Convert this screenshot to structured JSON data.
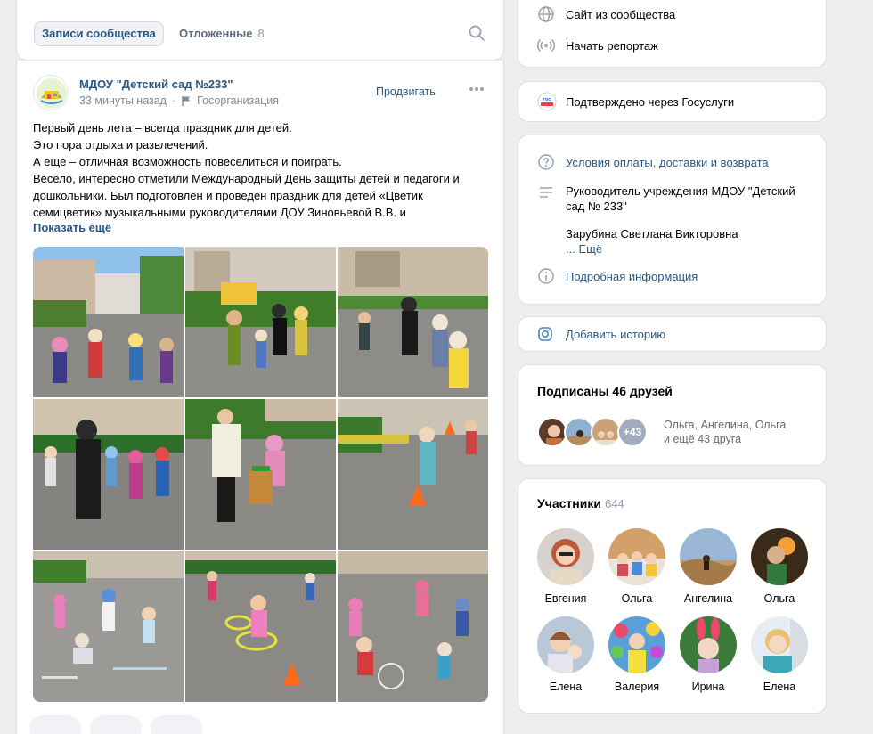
{
  "tabs": {
    "active": "Записи сообщества",
    "postponed": "Отложенные",
    "postponed_count": "8"
  },
  "post": {
    "author": "МДОУ \"Детский сад №233\"",
    "time": "33 минуты назад",
    "separator": "·",
    "org_type": "Госорганизация",
    "promote": "Продвигать",
    "text_lines": [
      "Первый день лета – всегда праздник для детей.",
      "Это пора отдыха и развлечений.",
      "А еще – отличная возможность повеселиться и поиграть.",
      "Весело, интересно отметили Международный День защиты детей и педагоги и",
      "дошкольники. Был подготовлен и проведен праздник для детей «Цветик",
      "семицветик» музыкальными руководителями ДОУ Зиновьевой В.В. и"
    ],
    "show_more": "Показать ещё"
  },
  "links": {
    "site": "Сайт из сообщества",
    "report": "Начать репортаж"
  },
  "gos": {
    "label": "Подтверждено через Госуслуги",
    "badge": "ГОС УСЛУГИ"
  },
  "info": {
    "terms": "Условия оплаты, доставки и возврата",
    "head_line1": "Руководитель учреждения МДОУ \"Детский",
    "head_line2": "сад № 233\"",
    "head_name": "Зарубина Светлана Викторовна",
    "more": "... Ещё",
    "details": "Подробная информация"
  },
  "story": {
    "label": "Добавить историю"
  },
  "friends": {
    "title": "Подписаны 46 друзей",
    "more_badge": "+43",
    "names_line1": "Ольга, Ангелина, Ольга",
    "names_line2": "и ещё 43 друга"
  },
  "members": {
    "title": "Участники",
    "count": "644",
    "list": [
      {
        "name": "Евгения"
      },
      {
        "name": "Ольга"
      },
      {
        "name": "Ангелина"
      },
      {
        "name": "Ольга"
      },
      {
        "name": "Елена"
      },
      {
        "name": "Валерия"
      },
      {
        "name": "Ирина"
      },
      {
        "name": "Елена"
      }
    ]
  },
  "colors": {
    "link": "#2a5885",
    "background": "#edeef0",
    "card": "#ffffff"
  }
}
